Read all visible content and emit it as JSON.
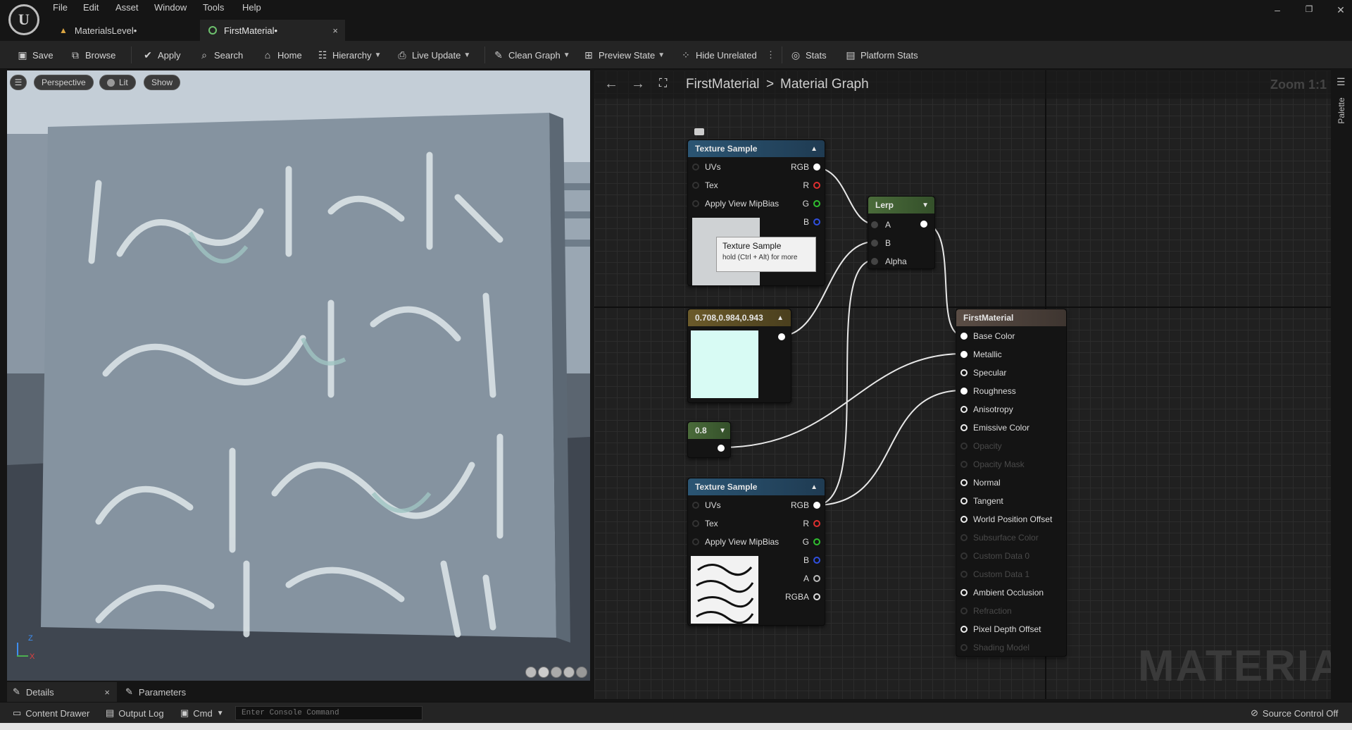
{
  "menu": [
    "File",
    "Edit",
    "Asset",
    "Window",
    "Tools",
    "Help"
  ],
  "tabs": [
    {
      "label": "MaterialsLevel•"
    },
    {
      "label": "FirstMaterial•",
      "close": "×"
    }
  ],
  "toolbar": {
    "save": "Save",
    "browse": "Browse",
    "apply": "Apply",
    "search": "Search",
    "home": "Home",
    "hierarchy": "Hierarchy",
    "live_update": "Live Update",
    "clean_graph": "Clean Graph",
    "preview_state": "Preview State",
    "hide_unrelated": "Hide Unrelated",
    "stats": "Stats",
    "platform_stats": "Platform Stats"
  },
  "viewport": {
    "perspective": "Perspective",
    "lit": "Lit",
    "show": "Show",
    "axis_z": "Z",
    "axis_x": "X"
  },
  "graph": {
    "breadcrumb_asset": "FirstMaterial",
    "breadcrumb_sep": ">",
    "breadcrumb_graph": "Material Graph",
    "zoom": "Zoom 1:1",
    "palette": "Palette",
    "watermark": "MATERIAL",
    "texture1": {
      "title": "Texture Sample",
      "inputs": [
        "UVs",
        "Tex",
        "Apply View MipBias"
      ],
      "outputs": [
        "RGB",
        "R",
        "G",
        "B"
      ]
    },
    "tooltip": {
      "title": "Texture Sample",
      "hint": "hold (Ctrl + Alt) for more"
    },
    "constant3": {
      "title": "0.708,0.984,0.943",
      "color": "#d8fbf4"
    },
    "constant": {
      "title": "0.8"
    },
    "lerp": {
      "title": "Lerp",
      "inputs": [
        "A",
        "B",
        "Alpha"
      ]
    },
    "texture2": {
      "title": "Texture Sample",
      "inputs": [
        "UVs",
        "Tex",
        "Apply View MipBias"
      ],
      "outputs": [
        "RGB",
        "R",
        "G",
        "B",
        "A",
        "RGBA"
      ]
    },
    "result": {
      "title": "FirstMaterial",
      "pins": [
        {
          "label": "Base Color",
          "state": "full"
        },
        {
          "label": "Metallic",
          "state": "full"
        },
        {
          "label": "Specular",
          "state": "on"
        },
        {
          "label": "Roughness",
          "state": "full"
        },
        {
          "label": "Anisotropy",
          "state": "on"
        },
        {
          "label": "Emissive Color",
          "state": "on"
        },
        {
          "label": "Opacity",
          "state": "dim"
        },
        {
          "label": "Opacity Mask",
          "state": "dim"
        },
        {
          "label": "Normal",
          "state": "on"
        },
        {
          "label": "Tangent",
          "state": "on"
        },
        {
          "label": "World Position Offset",
          "state": "on"
        },
        {
          "label": "Subsurface Color",
          "state": "dim"
        },
        {
          "label": "Custom Data 0",
          "state": "dim"
        },
        {
          "label": "Custom Data 1",
          "state": "dim"
        },
        {
          "label": "Ambient Occlusion",
          "state": "on"
        },
        {
          "label": "Refraction",
          "state": "dim"
        },
        {
          "label": "Pixel Depth Offset",
          "state": "on"
        },
        {
          "label": "Shading Model",
          "state": "dim"
        }
      ]
    }
  },
  "bottom": {
    "details": "Details",
    "details_close": "×",
    "parameters": "Parameters",
    "content_drawer": "Content Drawer",
    "output_log": "Output Log",
    "cmd": "Cmd",
    "console_placeholder": "Enter Console Command",
    "source_control": "Source Control Off"
  },
  "colors": {
    "accent_green": "#4a6b3a",
    "texture_header": "#2b5573",
    "lerp_header": "#4a6b3a",
    "constant_header": "#6b5a2a",
    "result_header": "#5a4d45"
  }
}
